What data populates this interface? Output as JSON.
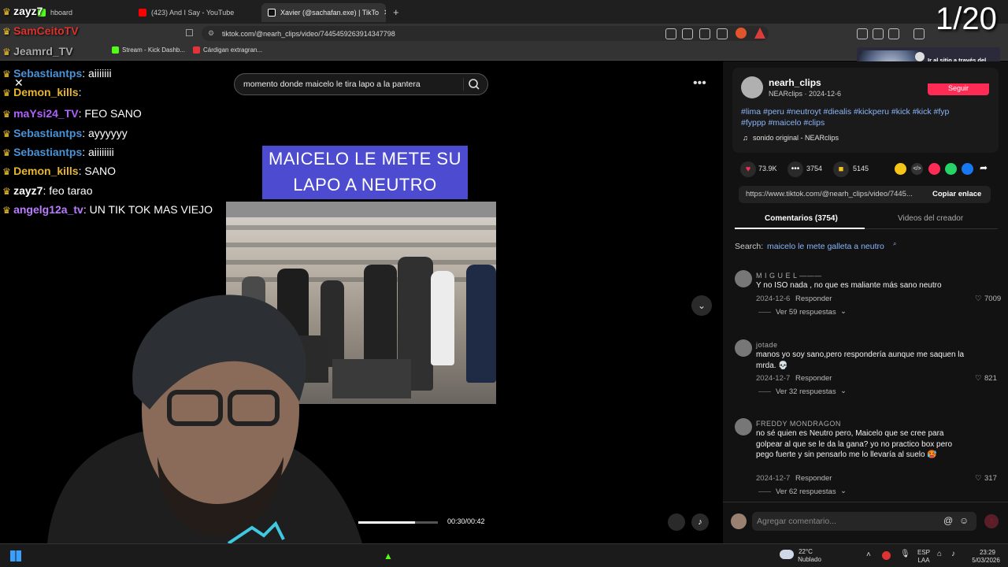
{
  "browser": {
    "tabs": [
      {
        "label": "hboard",
        "color": "#53fc18"
      },
      {
        "label": "(423) And I Say - YouTube",
        "color": "#ff0000"
      },
      {
        "label": "Xavier (@sachafan.exe) | TikTo",
        "color": "#ffffff"
      }
    ],
    "url": "tiktok.com/@nearh_clips/video/7445459263914347798",
    "bookmarks": [
      {
        "label": "Stream - Kick Dashb...",
        "color": "#53fc18"
      },
      {
        "label": "Cárdigan extragran...",
        "color": "#e53238"
      }
    ],
    "counter": "1/20"
  },
  "overlay": {
    "ad_text": "Ir al sitio a través del enlace en el chat o la descripción del canal"
  },
  "chat": [
    {
      "user": "zayz7",
      "color": "#ffffff",
      "msg": ""
    },
    {
      "user": "SamCeitoTV",
      "color": "#e0322d",
      "msg": ""
    },
    {
      "user": "Jeamrd_TV",
      "color": "#a8a8a8",
      "msg": ""
    },
    {
      "user": "Sebastiantps",
      "color": "#4a93d8",
      "msg": ": aiiiiiii"
    },
    {
      "user": "Demon_kills",
      "color": "#e8b62c",
      "msg": ":"
    },
    {
      "user": "maYsi24_TV",
      "color": "#b060ff",
      "msg": ": FEO SANO"
    },
    {
      "user": "Sebastiantps",
      "color": "#4a93d8",
      "msg": ": ayyyyyy"
    },
    {
      "user": "Sebastiantps",
      "color": "#4a93d8",
      "msg": ": aiiiiiiii"
    },
    {
      "user": "Demon_kills",
      "color": "#e8b62c",
      "msg": ": SANO"
    },
    {
      "user": "zayz7",
      "color": "#ffffff",
      "msg": ": feo tarao"
    },
    {
      "user": "angelg12a_tv",
      "color": "#b97cff",
      "msg": ": UN TIK TOK MAS VIEJO"
    }
  ],
  "tiktok": {
    "search_text": "momento donde maicelo le tira lapo a la pantera",
    "caption_line1": "MAICELO LE METE SU",
    "caption_line2": "LAPO A NEUTRO",
    "time": "00:30/00:42",
    "progress": 0.71,
    "author_handle": "nearh_clips",
    "author_meta": "NEARclips · 2024-12-6",
    "follow_label": "Seguir",
    "hashtags_line1": "#lima #peru #neutroyt #diealis #kickperu #kick #kick #fyp",
    "hashtags_line2": "#fyppp #maicelo #clips",
    "sound": "sonido original - NEARclips",
    "likes": "73.9K",
    "comments_count": "3754",
    "saves": "5145",
    "link": "https://www.tiktok.com/@nearh_clips/video/7445...",
    "copy_link": "Copiar enlace",
    "tab_comments": "Comentarios (3754)",
    "tab_creator": "Videos del creador",
    "search_label": "Search:",
    "search_query": "maicelo le mete galleta a neutro",
    "comments": [
      {
        "name": "M I G U E L ———",
        "text": "Y no ISO nada , no que es maliante más sano neutro",
        "date": "2024-12-6",
        "reply": "Responder",
        "likes": "7009",
        "more": "Ver 59 respuestas"
      },
      {
        "name": "jotade",
        "text": "manos yo soy sano,pero respondería aunque me saquen la mrda. 💀",
        "date": "2024-12-7",
        "reply": "Responder",
        "likes": "821",
        "more": "Ver 32 respuestas"
      },
      {
        "name": "FREDDY MONDRAGON",
        "text": "no sé quien es Neutro pero, Maicelo que se cree para golpear al que se le da la gana? yo no practico box pero pego fuerte y sin pensarlo me lo llevaría al suelo 🥵",
        "date": "2024-12-7",
        "reply": "Responder",
        "likes": "317",
        "more": "Ver 62 respuestas"
      }
    ],
    "comment_placeholder": "Agregar comentario..."
  },
  "taskbar": {
    "weather_temp": "22°C",
    "weather_desc": "Nublado",
    "lang1": "ESP",
    "lang2": "LAA",
    "clock_time": "23:29",
    "clock_date": "5/03/2026"
  },
  "colors": {
    "accent": "#fe2c55",
    "caption_bg": "#4d4bcf",
    "hashtag": "#8ab4f8"
  }
}
